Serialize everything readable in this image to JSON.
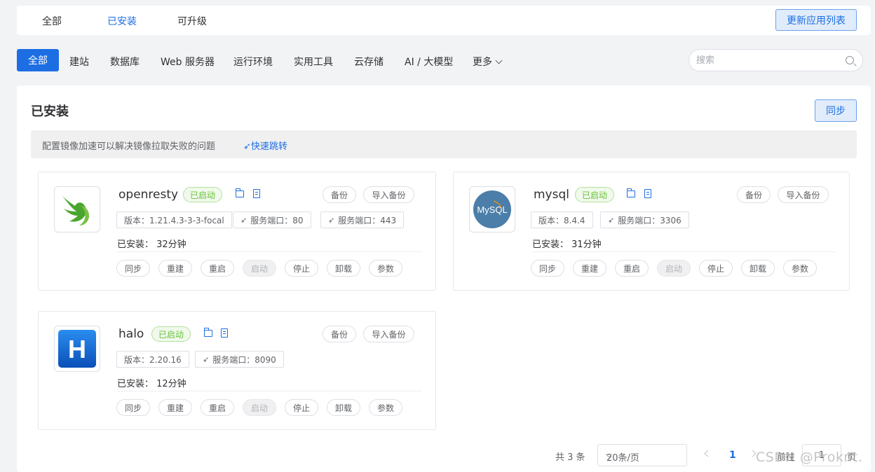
{
  "top_tabs": [
    "全部",
    "已安装",
    "可升级"
  ],
  "refresh_label": "更新应用列表",
  "categories": [
    "全部",
    "建站",
    "数据库",
    "Web 服务器",
    "运行环境",
    "实用工具",
    "云存储",
    "AI / 大模型",
    "更多"
  ],
  "search_placeholder": "搜索",
  "panel": {
    "title": "已安装",
    "sync_label": "同步",
    "notice_text": "配置镜像加速可以解决镜像拉取失败的问题",
    "notice_link": "快速跳转"
  },
  "apps": [
    {
      "name": "openresty",
      "status": "已启动",
      "backup": "备份",
      "import_backup": "导入备份",
      "tags": [
        "版本：1.21.4.3-3-3-focal",
        "服务端口：80",
        "服务端口：443"
      ],
      "installed": "已安装：  32分钟",
      "actions": [
        "同步",
        "重建",
        "重启",
        "启动",
        "停止",
        "卸载",
        "参数"
      ],
      "logo": "openresty-logo"
    },
    {
      "name": "mysql",
      "status": "已启动",
      "backup": "备份",
      "import_backup": "导入备份",
      "tags": [
        "版本：8.4.4",
        "服务端口：3306"
      ],
      "installed": "已安装：  31分钟",
      "actions": [
        "同步",
        "重建",
        "重启",
        "启动",
        "停止",
        "卸载",
        "参数"
      ],
      "logo": "mysql-logo",
      "logo_text": "MySQL"
    },
    {
      "name": "halo",
      "status": "已启动",
      "backup": "备份",
      "import_backup": "导入备份",
      "tags": [
        "版本：2.20.16",
        "服务端口：8090"
      ],
      "installed": "已安装：  12分钟",
      "actions": [
        "同步",
        "重建",
        "重启",
        "启动",
        "停止",
        "卸载",
        "参数"
      ],
      "logo": "halo-logo",
      "logo_text": "H"
    }
  ],
  "pagination": {
    "total": "共 3 条",
    "page_size": "20条/页",
    "current": "1",
    "goto": "前往",
    "goto_value": "1",
    "unit": "页"
  },
  "watermark": "CSDN @Proknt."
}
